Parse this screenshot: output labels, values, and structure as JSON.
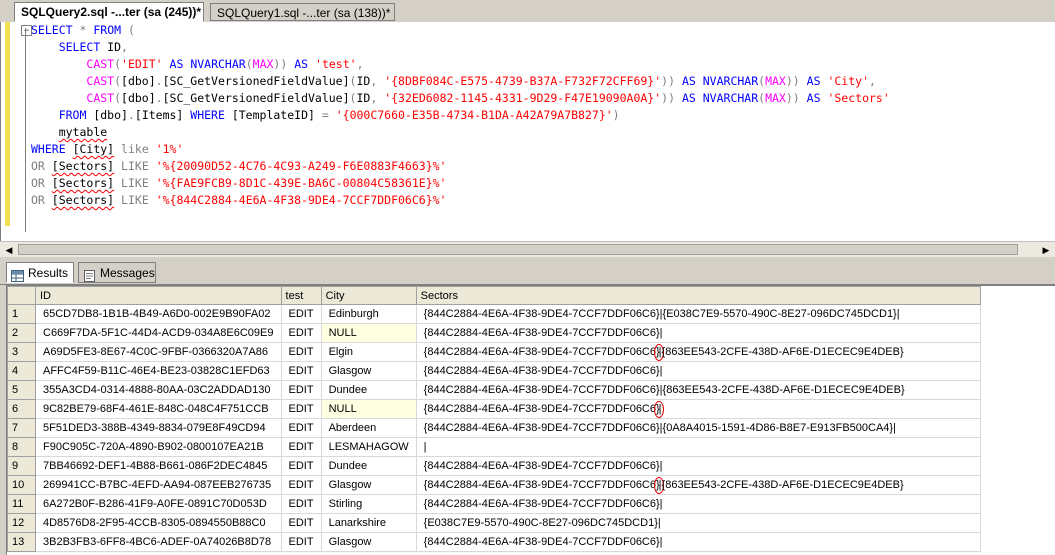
{
  "tabs": [
    {
      "label": "SQLQuery2.sql -...ter (sa (245))*",
      "active": true
    },
    {
      "label": "SQLQuery1.sql -...ter (sa (138))*",
      "active": false
    }
  ],
  "editor": {
    "lines": [
      [
        [
          "k",
          "SELECT"
        ],
        [
          "p",
          " "
        ],
        [
          "g",
          "*"
        ],
        [
          "p",
          " "
        ],
        [
          "k",
          "FROM"
        ],
        [
          "p",
          " "
        ],
        [
          "g",
          "("
        ]
      ],
      [
        [
          "p",
          "    "
        ],
        [
          "k",
          "SELECT"
        ],
        [
          "p",
          " ID"
        ],
        [
          "g",
          ","
        ]
      ],
      [
        [
          "p",
          "        "
        ],
        [
          "f",
          "CAST"
        ],
        [
          "g",
          "("
        ],
        [
          "s",
          "'EDIT'"
        ],
        [
          "p",
          " "
        ],
        [
          "k",
          "AS"
        ],
        [
          "p",
          " "
        ],
        [
          "k",
          "NVARCHAR"
        ],
        [
          "g",
          "("
        ],
        [
          "f",
          "MAX"
        ],
        [
          "g",
          "))"
        ],
        [
          "p",
          " "
        ],
        [
          "k",
          "AS"
        ],
        [
          "p",
          " "
        ],
        [
          "s",
          "'test'"
        ],
        [
          "g",
          ","
        ]
      ],
      [
        [
          "p",
          "        "
        ],
        [
          "f",
          "CAST"
        ],
        [
          "g",
          "("
        ],
        [
          "p",
          "[dbo]"
        ],
        [
          "g",
          "."
        ],
        [
          "p",
          "[SC_GetVersionedFieldValue]"
        ],
        [
          "g",
          "("
        ],
        [
          "p",
          "ID"
        ],
        [
          "g",
          ","
        ],
        [
          "p",
          " "
        ],
        [
          "s",
          "'{8DBF084C-E575-4739-B37A-F732F72CFF69}'"
        ],
        [
          "g",
          "))"
        ],
        [
          "p",
          " "
        ],
        [
          "k",
          "AS"
        ],
        [
          "p",
          " "
        ],
        [
          "k",
          "NVARCHAR"
        ],
        [
          "g",
          "("
        ],
        [
          "f",
          "MAX"
        ],
        [
          "g",
          "))"
        ],
        [
          "p",
          " "
        ],
        [
          "k",
          "AS"
        ],
        [
          "p",
          " "
        ],
        [
          "s",
          "'City'"
        ],
        [
          "g",
          ","
        ]
      ],
      [
        [
          "p",
          "        "
        ],
        [
          "f",
          "CAST"
        ],
        [
          "g",
          "("
        ],
        [
          "p",
          "[dbo]"
        ],
        [
          "g",
          "."
        ],
        [
          "p",
          "[SC_GetVersionedFieldValue]"
        ],
        [
          "g",
          "("
        ],
        [
          "p",
          "ID"
        ],
        [
          "g",
          ","
        ],
        [
          "p",
          " "
        ],
        [
          "s",
          "'{32ED6082-1145-4331-9D29-F47E19090A0A}'"
        ],
        [
          "g",
          "))"
        ],
        [
          "p",
          " "
        ],
        [
          "k",
          "AS"
        ],
        [
          "p",
          " "
        ],
        [
          "k",
          "NVARCHAR"
        ],
        [
          "g",
          "("
        ],
        [
          "f",
          "MAX"
        ],
        [
          "g",
          "))"
        ],
        [
          "p",
          " "
        ],
        [
          "k",
          "AS"
        ],
        [
          "p",
          " "
        ],
        [
          "s",
          "'Sectors'"
        ]
      ],
      [
        [
          "p",
          "    "
        ],
        [
          "k",
          "FROM"
        ],
        [
          "p",
          " [dbo]"
        ],
        [
          "g",
          "."
        ],
        [
          "p",
          "[Items] "
        ],
        [
          "k",
          "WHERE"
        ],
        [
          "p",
          " [TemplateID] "
        ],
        [
          "g",
          "="
        ],
        [
          "p",
          " "
        ],
        [
          "s",
          "'{000C7660-E35B-4734-B1DA-A42A79A7B827}'"
        ],
        [
          "g",
          ")"
        ]
      ],
      [
        [
          "p",
          "    "
        ],
        [
          "q",
          "mytable"
        ]
      ],
      [
        [
          "k",
          "WHERE"
        ],
        [
          "p",
          " "
        ],
        [
          "q",
          "[City]"
        ],
        [
          "p",
          " "
        ],
        [
          "g",
          "like"
        ],
        [
          "p",
          " "
        ],
        [
          "s",
          "'1%'"
        ]
      ],
      [
        [
          "g",
          "OR"
        ],
        [
          "p",
          " "
        ],
        [
          "q",
          "[Sectors]"
        ],
        [
          "p",
          " "
        ],
        [
          "g",
          "LIKE"
        ],
        [
          "p",
          " "
        ],
        [
          "s",
          "'%{20090D52-4C76-4C93-A249-F6E0883F4663}%'"
        ]
      ],
      [
        [
          "g",
          "OR"
        ],
        [
          "p",
          " "
        ],
        [
          "q",
          "[Sectors]"
        ],
        [
          "p",
          " "
        ],
        [
          "g",
          "LIKE"
        ],
        [
          "p",
          " "
        ],
        [
          "s",
          "'%{FAE9FCB9-8D1C-439E-BA6C-00804C58361E}%'"
        ]
      ],
      [
        [
          "g",
          "OR"
        ],
        [
          "p",
          " "
        ],
        [
          "q",
          "[Sectors]"
        ],
        [
          "p",
          " "
        ],
        [
          "g",
          "LIKE"
        ],
        [
          "p",
          " "
        ],
        [
          "s",
          "'%{844C2884-4E6A-4F38-9DE4-7CCF7DDF06C6}%'"
        ]
      ]
    ]
  },
  "results_tabs": {
    "results_label": "Results",
    "messages_label": "Messages"
  },
  "grid": {
    "columns": [
      "",
      "ID",
      "test",
      "City",
      "Sectors"
    ],
    "rows": [
      {
        "n": "1",
        "id": "65CD7DB8-1B1B-4B49-A6D0-002E9B90FA02",
        "test": "EDIT",
        "city": "Edinburgh",
        "city_null": false,
        "sectors": "{844C2884-4E6A-4F38-9DE4-7CCF7DDF06C6}|{E038C7E9-5570-490C-8E27-096DC745DCD1}|",
        "mark": false
      },
      {
        "n": "2",
        "id": "C669F7DA-5F1C-44D4-ACD9-034A8E6C09E9",
        "test": "EDIT",
        "city": "NULL",
        "city_null": true,
        "sectors": "{844C2884-4E6A-4F38-9DE4-7CCF7DDF06C6}|",
        "mark": false
      },
      {
        "n": "3",
        "id": "A69D5FE3-8E67-4C0C-9FBF-0366320A7A86",
        "test": "EDIT",
        "city": "Elgin",
        "city_null": false,
        "sectors": "{844C2884-4E6A-4F38-9DE4-7CCF7DDF06C6}|{863EE543-2CFE-438D-AF6E-D1ECEC9E4DEB}",
        "mark": true
      },
      {
        "n": "4",
        "id": "AFFC4F59-B11C-46E4-BE23-03828C1EFD63",
        "test": "EDIT",
        "city": "Glasgow",
        "city_null": false,
        "sectors": "{844C2884-4E6A-4F38-9DE4-7CCF7DDF06C6}|",
        "mark": false
      },
      {
        "n": "5",
        "id": "355A3CD4-0314-4888-80AA-03C2ADDAD130",
        "test": "EDIT",
        "city": "Dundee",
        "city_null": false,
        "sectors": "{844C2884-4E6A-4F38-9DE4-7CCF7DDF06C6}|{863EE543-2CFE-438D-AF6E-D1ECEC9E4DEB}",
        "mark": false
      },
      {
        "n": "6",
        "id": "9C82BE79-68F4-461E-848C-048C4F751CCB",
        "test": "EDIT",
        "city": "NULL",
        "city_null": true,
        "sectors": "{844C2884-4E6A-4F38-9DE4-7CCF7DDF06C6}|",
        "mark": true
      },
      {
        "n": "7",
        "id": "5F51DED3-388B-4349-8834-079E8F49CD94",
        "test": "EDIT",
        "city": "Aberdeen",
        "city_null": false,
        "sectors": "{844C2884-4E6A-4F38-9DE4-7CCF7DDF06C6}|{0A8A4015-1591-4D86-B8E7-E913FB500CA4}|",
        "mark": false
      },
      {
        "n": "8",
        "id": "F90C905C-720A-4890-B902-0800107EA21B",
        "test": "EDIT",
        "city": "LESMAHAGOW",
        "city_null": false,
        "sectors": "|",
        "mark": false
      },
      {
        "n": "9",
        "id": "7BB46692-DEF1-4B88-B661-086F2DEC4845",
        "test": "EDIT",
        "city": "Dundee",
        "city_null": false,
        "sectors": "{844C2884-4E6A-4F38-9DE4-7CCF7DDF06C6}|",
        "mark": false
      },
      {
        "n": "10",
        "id": "269941CC-B7BC-4EFD-AA94-087EEB276735",
        "test": "EDIT",
        "city": "Glasgow",
        "city_null": false,
        "sectors": "{844C2884-4E6A-4F38-9DE4-7CCF7DDF06C6}|{863EE543-2CFE-438D-AF6E-D1ECEC9E4DEB}",
        "mark": true
      },
      {
        "n": "11",
        "id": "6A272B0F-B286-41F9-A0FE-0891C70D053D",
        "test": "EDIT",
        "city": "Stirling",
        "city_null": false,
        "sectors": "{844C2884-4E6A-4F38-9DE4-7CCF7DDF06C6}|",
        "mark": false
      },
      {
        "n": "12",
        "id": "4D8576D8-2F95-4CCB-8305-0894550B88C0",
        "test": "EDIT",
        "city": "Lanarkshire",
        "city_null": false,
        "sectors": "{E038C7E9-5570-490C-8E27-096DC745DCD1}|",
        "mark": false
      },
      {
        "n": "13",
        "id": "3B2B3FB3-6FF8-4BC6-ADEF-0A74026B8D78",
        "test": "EDIT",
        "city": "Glasgow",
        "city_null": false,
        "sectors": "{844C2884-4E6A-4F38-9DE4-7CCF7DDF06C6}|",
        "mark": false
      }
    ]
  }
}
